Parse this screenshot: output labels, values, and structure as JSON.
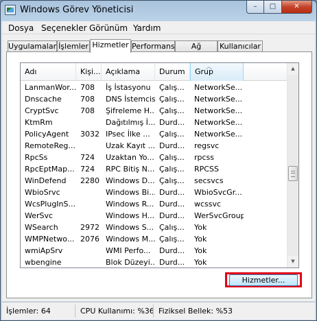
{
  "window": {
    "title": "Windows Görev Yöneticisi",
    "controls": {
      "minimize": "–",
      "maximize": "□",
      "close": "✕"
    }
  },
  "menu": [
    "Dosya",
    "Seçenekler",
    "Görünüm",
    "Yardım"
  ],
  "tabs": [
    {
      "label": "Uygulamalar"
    },
    {
      "label": "İşlemler"
    },
    {
      "label": "Hizmetler",
      "active": true
    },
    {
      "label": "Performans"
    },
    {
      "label": "Ağ İletişimi"
    },
    {
      "label": "Kullanıcılar"
    }
  ],
  "table": {
    "columns": [
      "Adı",
      "Kişi...",
      "Açıklama",
      "Durum",
      "Grup"
    ],
    "sorted_column": "Grup",
    "rows": [
      [
        "LanmanWor...",
        "708",
        "İş İstasyonu",
        "Çalış...",
        "NetworkSe..."
      ],
      [
        "Dnscache",
        "708",
        "DNS İstemcisi",
        "Çalış...",
        "NetworkSe..."
      ],
      [
        "CryptSvc",
        "708",
        "Şifreleme H...",
        "Çalış...",
        "NetworkSe..."
      ],
      [
        "KtmRm",
        "",
        "Dağıtılmış İ...",
        "Durd...",
        "NetworkSe..."
      ],
      [
        "PolicyAgent",
        "3032",
        "IPsec İlke ...",
        "Çalış...",
        "NetworkSe..."
      ],
      [
        "RemoteReg...",
        "",
        "Uzak Kayıt ...",
        "Durd...",
        "regsvc"
      ],
      [
        "RpcSs",
        "724",
        "Uzaktan Yo...",
        "Çalış...",
        "rpcss"
      ],
      [
        "RpcEptMap...",
        "724",
        "RPC Bitiş N...",
        "Çalış...",
        "RPCSS"
      ],
      [
        "WinDefend",
        "2280",
        "Windows D...",
        "Çalış...",
        "secsvcs"
      ],
      [
        "WbioSrvc",
        "",
        "Windows Bi...",
        "Durd...",
        "WbioSvcGr..."
      ],
      [
        "WcsPlugInS...",
        "",
        "Windows R...",
        "Durd...",
        "wcssvc"
      ],
      [
        "WerSvc",
        "",
        "Windows H...",
        "Durd...",
        "WerSvcGroup"
      ],
      [
        "WSearch",
        "2972",
        "Windows S...",
        "Çalış...",
        "Yok"
      ],
      [
        "WMPNetwo...",
        "2076",
        "Windows M...",
        "Çalış...",
        "Yok"
      ],
      [
        "wmiApSrv",
        "",
        "WMI Perfo...",
        "Durd...",
        "Yok"
      ],
      [
        "wbengine",
        "",
        "Blok Düzeyi...",
        "Durd...",
        "Yok"
      ]
    ]
  },
  "buttons": {
    "services": "Hizmetler..."
  },
  "statusbar": {
    "processes": "İşlemler: 64",
    "cpu": "CPU Kullanımı: %36",
    "memory": "Fiziksel Bellek: %53"
  },
  "colors": {
    "highlight_box": "#e00018",
    "window_frame": "#a9c3dd"
  }
}
